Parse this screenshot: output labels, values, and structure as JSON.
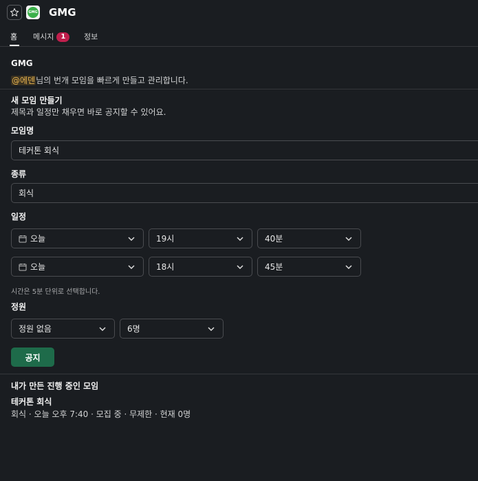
{
  "header": {
    "title": "GMG",
    "app_icon_text": "GMG",
    "star_icon": "star-icon"
  },
  "tabs": [
    {
      "label": "홈",
      "active": true
    },
    {
      "label": "메시지",
      "badge": "1"
    },
    {
      "label": "정보"
    }
  ],
  "intro": {
    "title": "GMG",
    "mention": "@에덴",
    "text": "님의 번개 모임을 빠르게 만들고 관리합니다."
  },
  "create": {
    "title": "새 모임 만들기",
    "subtitle": "제목과 일정만 채우면 바로 공지할 수 있어요."
  },
  "form": {
    "name_label": "모임명",
    "name_value": "테커톤 회식",
    "type_label": "종류",
    "type_value": "회식",
    "schedule_label": "일정",
    "start": {
      "date": "오늘",
      "hour": "19시",
      "minute": "40분"
    },
    "end": {
      "date": "오늘",
      "hour": "18시",
      "minute": "45분"
    },
    "time_hint": "시간은 5분 단위로 선택합니다.",
    "capacity_label": "정원",
    "capacity_mode": "정원 없음",
    "capacity_count": "6명",
    "submit_label": "공지"
  },
  "my_meetings": {
    "title": "내가 만든 진행 중인 모임",
    "items": [
      {
        "name": "테커톤 회식",
        "details": "회식 · 오늘 오후 7:40 · 모집 중 · 무제한 · 현재 0명"
      }
    ]
  },
  "colors": {
    "background": "#1a1d21",
    "accent": "#1e6b4a",
    "badge": "#c01e4c",
    "mention": "#e8b44f"
  }
}
